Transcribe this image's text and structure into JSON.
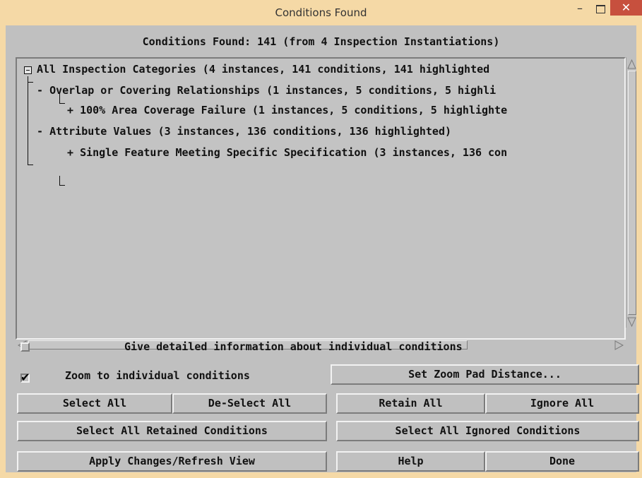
{
  "window": {
    "title": "Conditions Found",
    "minimize_glyph": "–",
    "close_glyph": "✕"
  },
  "heading": "Conditions Found: 141 (from 4 Inspection Instantiations)",
  "tree": {
    "items": [
      {
        "prefix": "",
        "text": "All Inspection Categories (4 instances, 141 conditions, 141 highlighted"
      },
      {
        "prefix": "- ",
        "text": "Overlap or Covering Relationships (1 instances, 5 conditions, 5 highli"
      },
      {
        "prefix": "+ ",
        "text": "100% Area Coverage Failure (1 instances, 5 conditions, 5 highlighte"
      },
      {
        "prefix": "- ",
        "text": "Attribute Values (3 instances, 136 conditions, 136 highlighted)"
      },
      {
        "prefix": "+ ",
        "text": "Single Feature Meeting Specific Specification (3 instances, 136 con"
      }
    ]
  },
  "options": {
    "detailed_info_label": "Give detailed information about individual conditions",
    "detailed_info_checked": false,
    "zoom_label": "Zoom to individual conditions",
    "zoom_checked": true,
    "check_glyph": "✔"
  },
  "buttons": {
    "set_zoom_pad": "Set Zoom Pad Distance...",
    "select_all": "Select All",
    "deselect_all": "De-Select All",
    "retain_all": "Retain All",
    "ignore_all": "Ignore All",
    "select_retained": "Select All Retained Conditions",
    "select_ignored": "Select All Ignored Conditions",
    "apply_refresh": "Apply Changes/Refresh View",
    "help": "Help",
    "done": "Done"
  },
  "colors": {
    "window_frame": "#f5d9a6",
    "client_bg": "#c0c0c0",
    "close_button": "#c7503e"
  }
}
